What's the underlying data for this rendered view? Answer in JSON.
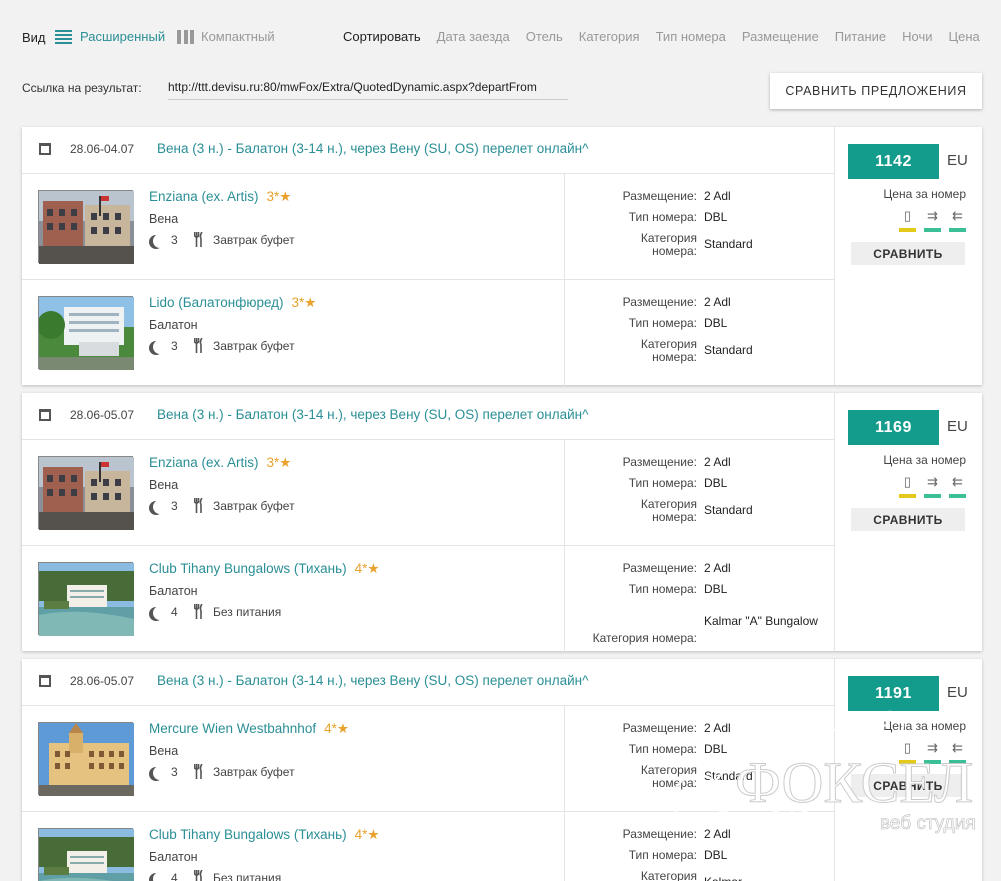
{
  "toolbar": {
    "view_label": "Вид",
    "view_extended": "Расширенный",
    "view_compact": "Компактный",
    "sort_label": "Сортировать",
    "sort_options": [
      "Дата заезда",
      "Отель",
      "Категория",
      "Тип номера",
      "Размещение",
      "Питание",
      "Ночи",
      "Цена"
    ]
  },
  "link": {
    "label": "Ссылка на результат:",
    "value": "http://ttt.devisu.ru:80/mwFox/Extra/QuotedDynamic.aspx?departFrom"
  },
  "compare_offers_button": "СРАВНИТЬ ПРЕДЛОЖЕНИЯ",
  "labels": {
    "placement": "Размещение:",
    "room_type": "Тип номера:",
    "category_line1": "Категория",
    "category_line2": "номера:",
    "category_full": "Категория номера:",
    "price_note": "Цена за номер",
    "compare": "СРАВНИТЬ"
  },
  "colors": {
    "accent": "#2a8f96",
    "price_bg": "#139c8c",
    "stars": "#e8a22d",
    "status_yellow": "#e2c91a",
    "status_green": "#3bbf96"
  },
  "status_icons": [
    "hotel-icon",
    "arrow-right-icon",
    "arrow-left-icon"
  ],
  "offers": [
    {
      "dates": "28.06-04.07",
      "route": "Вена (3 н.) - Балатон (3-14 н.), через Вену (SU, OS) перелет онлайн^",
      "price": "1142",
      "currency": "EU",
      "hotels": [
        {
          "name": "Enziana (ex. Artis)",
          "stars": "3*★",
          "city": "Вена",
          "nights": "3",
          "meal": "Завтрак буфет",
          "placement": "2 Adl",
          "room_type": "DBL",
          "category": "Standard",
          "photo": "city"
        },
        {
          "name": "Lido (Балатонфюред)",
          "stars": "3*★",
          "city": "Балатон",
          "nights": "3",
          "meal": "Завтрак буфет",
          "placement": "2 Adl",
          "room_type": "DBL",
          "category": "Standard",
          "photo": "lake"
        }
      ]
    },
    {
      "dates": "28.06-05.07",
      "route": "Вена (3 н.) - Балатон (3-14 н.), через Вену (SU, OS) перелет онлайн^",
      "price": "1169",
      "currency": "EU",
      "hotels": [
        {
          "name": "Enziana (ex. Artis)",
          "stars": "3*★",
          "city": "Вена",
          "nights": "3",
          "meal": "Завтрак буфет",
          "placement": "2 Adl",
          "room_type": "DBL",
          "category": "Standard",
          "photo": "city"
        },
        {
          "name": "Club Tihany Bungalows (Тихань)",
          "stars": "4*★",
          "city": "Балатон",
          "nights": "4",
          "meal": "Без питания",
          "placement": "2 Adl",
          "room_type": "DBL",
          "category": "Kalmar \"A\" Bungalow",
          "photo": "resort"
        }
      ]
    },
    {
      "dates": "28.06-05.07",
      "route": "Вена (3 н.) - Балатон (3-14 н.), через Вену (SU, OS) перелет онлайн^",
      "price": "1191",
      "currency": "EU",
      "hotels": [
        {
          "name": "Mercure Wien Westbahnhof",
          "stars": "4*★",
          "city": "Вена",
          "nights": "3",
          "meal": "Завтрак буфет",
          "placement": "2 Adl",
          "room_type": "DBL",
          "category": "Standard",
          "photo": "palace"
        },
        {
          "name": "Club Tihany Bungalows (Тихань)",
          "stars": "4*★",
          "city": "Балатон",
          "nights": "4",
          "meal": "Без питания",
          "placement": "2 Adl",
          "room_type": "DBL",
          "category": "Kalmar",
          "photo": "resort"
        }
      ]
    }
  ],
  "watermark": {
    "title": "ФОКСЕЛ",
    "subtitle": "веб студия"
  }
}
